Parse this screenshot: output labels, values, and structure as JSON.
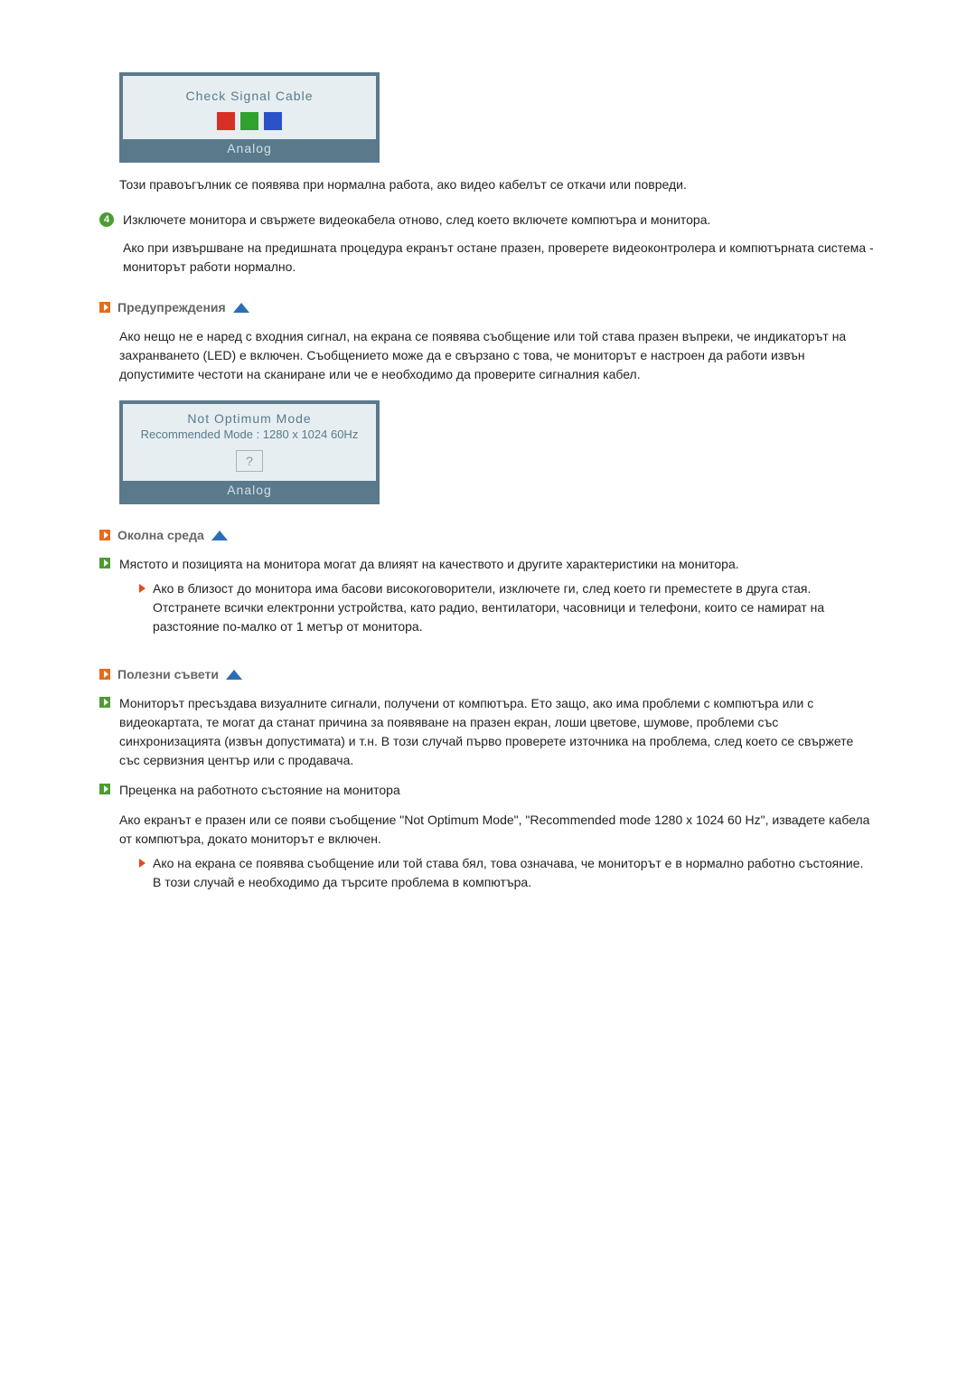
{
  "osd1": {
    "title": "Check Signal Cable",
    "footer": "Analog"
  },
  "osd2": {
    "line1": "Not Optimum Mode",
    "line2": "Recommended Mode : 1280 x 1024  60Hz",
    "mark": "?",
    "footer": "Analog"
  },
  "para1": "Този правоъгълник се появява при нормална работа, ако видео кабелът се откачи или повреди.",
  "step4": {
    "num": "4",
    "p1": "Изключете монитора и свържете видеокабела отново, след което включете компютъра и монитора.",
    "p2": "Ако при извършване на предишната процедура екранът остане празен, проверете видеоконтролера и компютърната система - мониторът работи нормално."
  },
  "warnings": {
    "title": "Предупреждения",
    "body": "Ако нещо не е наред с входния сигнал, на екрана се появява съобщение или той става празен въпреки, че индикаторът на захранването (LED) е включен. Съобщението може да е свързано с това, че мониторът е настроен да работи извън допустимите честоти на сканиране или че е необходимо да проверите сигналния кабел."
  },
  "env": {
    "title": "Околна среда",
    "bullet": "Мястото и позицията на монитора могат да влияят на качеството и другите характеристики на монитора.",
    "sub1": "Ако в близост до монитора има басови високоговорители, изключете ги, след което ги преместете в друга стая.",
    "sub2": "Отстранете всички електронни устройства, като радио, вентилатори, часовници и телефони, които се намират на разстояние по-малко от 1 метър от монитора."
  },
  "tips": {
    "title": "Полезни съвети",
    "b1": "Мониторът пресъздава визуалните сигнали, получени от компютъра. Ето защо, ако има проблеми с компютъра или с видеокартата, те могат да станат причина за появяване на празен екран, лоши цветове, шумове, проблеми със синхронизацията (извън допустимата) и т.н. В този случай първо проверете източника на проблема, след което се свържете със сервизния център или с продавача.",
    "b2_head": "Преценка на работното състояние на монитора",
    "b2_body": "Ако екранът е празен или се появи съобщение \"Not Optimum Mode\", \"Recommended mode 1280 x 1024 60 Hz\", извадете кабела от компютъра, докато мониторът е включен.",
    "b2_sub": "Ако на екрана се появява съобщение или той става бял, това означава, че мониторът е в нормално работно състояние.",
    "b2_sub2": "В този случай е необходимо да търсите проблема в компютъра."
  }
}
